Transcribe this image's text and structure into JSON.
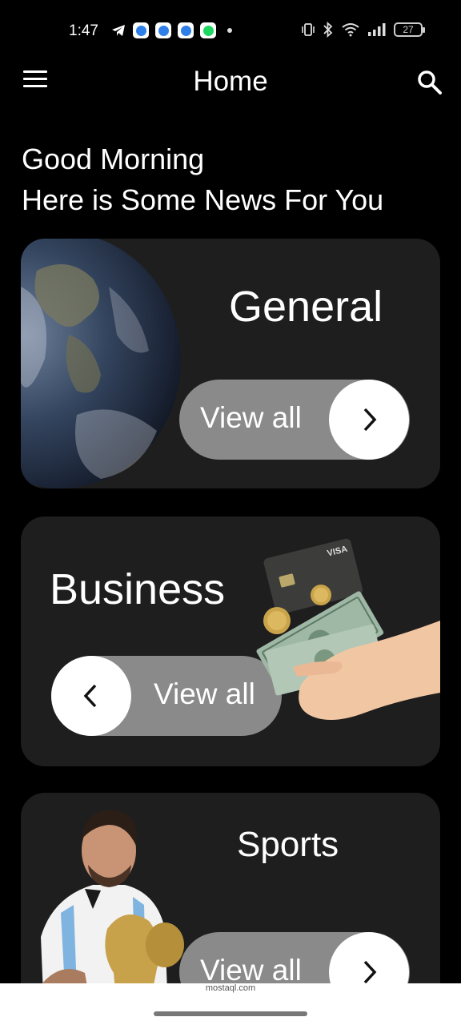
{
  "status_bar": {
    "time": "1:47",
    "battery": "27",
    "apps": [
      "telegram-icon",
      "app-icon",
      "app-icon",
      "app-icon",
      "spotify-icon"
    ]
  },
  "appbar": {
    "title": "Home"
  },
  "greeting": {
    "line1": "Good Morning",
    "line2": "Here is Some News For You"
  },
  "cards": [
    {
      "title": "General",
      "button_label": "View all",
      "image": "earth-globe-image"
    },
    {
      "title": "Business",
      "button_label": "View all",
      "image": "money-hand-image"
    },
    {
      "title": "Sports",
      "button_label": "View all",
      "image": "football-player-trophy-image"
    }
  ],
  "watermark": "mostaql.com",
  "colors": {
    "background": "#000000",
    "card": "#1e1e1e",
    "pill": "#8a8a8a",
    "text": "#ffffff"
  }
}
